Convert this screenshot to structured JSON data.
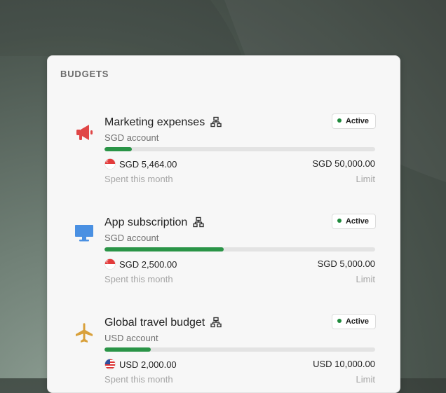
{
  "card": {
    "title": "BUDGETS"
  },
  "budgets": [
    {
      "name": "Marketing expenses",
      "account": "SGD account",
      "status": "Active",
      "spent": "SGD 5,464.00",
      "limit": "SGD 50,000.00",
      "spent_label": "Spent this month",
      "limit_label": "Limit",
      "progress": 0.1,
      "icon": "megaphone-icon",
      "icon_color": "#e04646",
      "flag": "singapore-flag-icon"
    },
    {
      "name": "App subscription",
      "account": "SGD account",
      "status": "Active",
      "spent": "SGD 2,500.00",
      "limit": "SGD 5,000.00",
      "spent_label": "Spent this month",
      "limit_label": "Limit",
      "progress": 0.44,
      "icon": "monitor-icon",
      "icon_color": "#4a90e2",
      "flag": "singapore-flag-icon"
    },
    {
      "name": "Global travel budget",
      "account": "USD account",
      "status": "Active",
      "spent": "USD 2,000.00",
      "limit": "USD 10,000.00",
      "spent_label": "Spent this month",
      "limit_label": "Limit",
      "progress": 0.17,
      "icon": "airplane-icon",
      "icon_color": "#d9a13c",
      "flag": "us-flag-icon"
    }
  ],
  "colors": {
    "progress_fill": "#2a9447",
    "progress_track": "#e3e3e3",
    "status_dot": "#1f8a3c"
  }
}
